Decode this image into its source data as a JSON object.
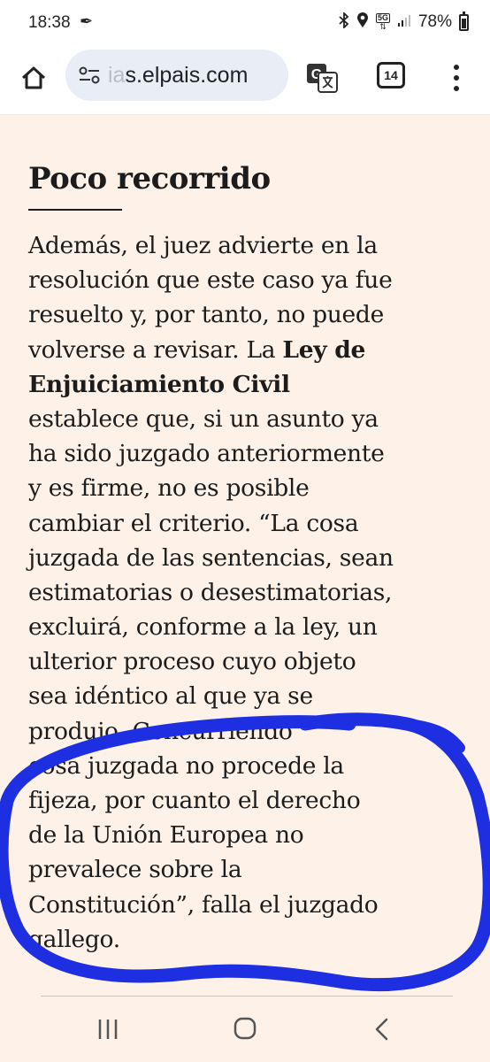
{
  "status_bar": {
    "time": "18:38",
    "battery_percent": "78%",
    "network_label": "5G"
  },
  "browser": {
    "url_faded": "ia",
    "url_visible": "s.elpais.com",
    "tab_count": "14"
  },
  "article": {
    "heading": "Poco recorrido",
    "lines": [
      {
        "pre": "Además, el juez advierte en la",
        "bold": "",
        "post": ""
      },
      {
        "pre": "resolución que este caso ya fue",
        "bold": "",
        "post": ""
      },
      {
        "pre": "resuelto y, por tanto, no puede",
        "bold": "",
        "post": ""
      },
      {
        "pre": "volverse a revisar. La ",
        "bold": "Ley de",
        "post": ""
      },
      {
        "pre": "",
        "bold": "Enjuiciamiento Civil",
        "post": ""
      },
      {
        "pre": "establece que, si un asunto ya",
        "bold": "",
        "post": ""
      },
      {
        "pre": "ha sido juzgado anteriormente",
        "bold": "",
        "post": ""
      },
      {
        "pre": "y es firme, no es posible",
        "bold": "",
        "post": ""
      },
      {
        "pre": "cambiar el criterio. “La cosa",
        "bold": "",
        "post": ""
      },
      {
        "pre": "juzgada de las sentencias, sean",
        "bold": "",
        "post": ""
      },
      {
        "pre": "estimatorias o desestimatorias,",
        "bold": "",
        "post": ""
      },
      {
        "pre": "excluirá, conforme a la ley, un",
        "bold": "",
        "post": ""
      },
      {
        "pre": "ulterior proceso cuyo objeto",
        "bold": "",
        "post": ""
      },
      {
        "pre": "sea idéntico al que ya se",
        "bold": "",
        "post": ""
      },
      {
        "pre": "produjo. Concurriendo",
        "bold": "",
        "post": ""
      },
      {
        "pre": "cosa juzgada no procede la",
        "bold": "",
        "post": ""
      },
      {
        "pre": "fijeza, por cuanto el derecho",
        "bold": "",
        "post": ""
      },
      {
        "pre": "de la Unión Europea no",
        "bold": "",
        "post": ""
      },
      {
        "pre": "prevalece sobre la",
        "bold": "",
        "post": ""
      },
      {
        "pre": "Constitución”, falla el juzgado",
        "bold": "",
        "post": ""
      },
      {
        "pre": "gallego.",
        "bold": "",
        "post": ""
      }
    ]
  },
  "annotation": {
    "color": "#1d2fe0"
  },
  "icons": {
    "home": "home-icon",
    "url_options": "tune-icon",
    "translate": "translate-icon",
    "menu": "more-vert-icon",
    "recents": "recents-icon",
    "nav_home": "nav-home-icon",
    "back": "back-icon"
  }
}
